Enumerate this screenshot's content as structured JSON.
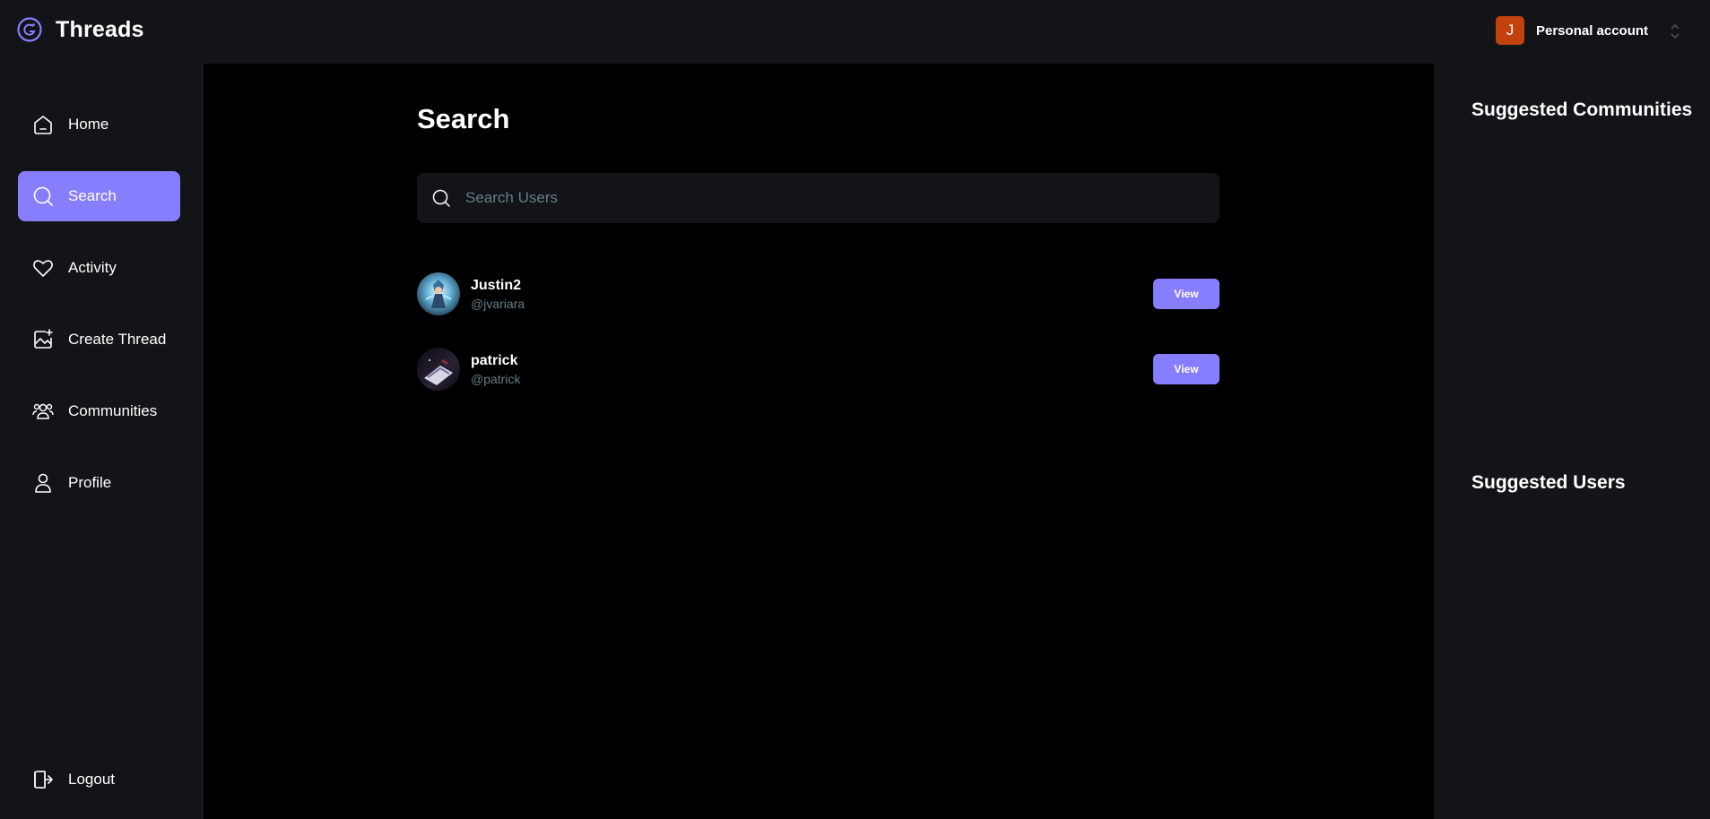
{
  "app": {
    "name": "Threads",
    "accent": "#877eff",
    "logo_icon": "threads-logo-icon"
  },
  "account": {
    "initial": "J",
    "name": "Personal account",
    "avatar_color": "#c2410c"
  },
  "sidebar": {
    "items": [
      {
        "label": "Home",
        "icon": "home-icon",
        "active": false
      },
      {
        "label": "Search",
        "icon": "search-icon",
        "active": true
      },
      {
        "label": "Activity",
        "icon": "heart-icon",
        "active": false
      },
      {
        "label": "Create Thread",
        "icon": "create-image-icon",
        "active": false
      },
      {
        "label": "Communities",
        "icon": "communities-icon",
        "active": false
      },
      {
        "label": "Profile",
        "icon": "user-icon",
        "active": false
      }
    ],
    "logout": {
      "label": "Logout",
      "icon": "logout-icon"
    }
  },
  "main": {
    "title": "Search",
    "search": {
      "placeholder": "Search Users",
      "value": ""
    },
    "users": [
      {
        "name": "Justin2",
        "handle": "@jvariara",
        "button": "View"
      },
      {
        "name": "patrick",
        "handle": "@patrick",
        "button": "View"
      }
    ]
  },
  "rightbar": {
    "communities_heading": "Suggested Communities",
    "users_heading": "Suggested Users"
  }
}
